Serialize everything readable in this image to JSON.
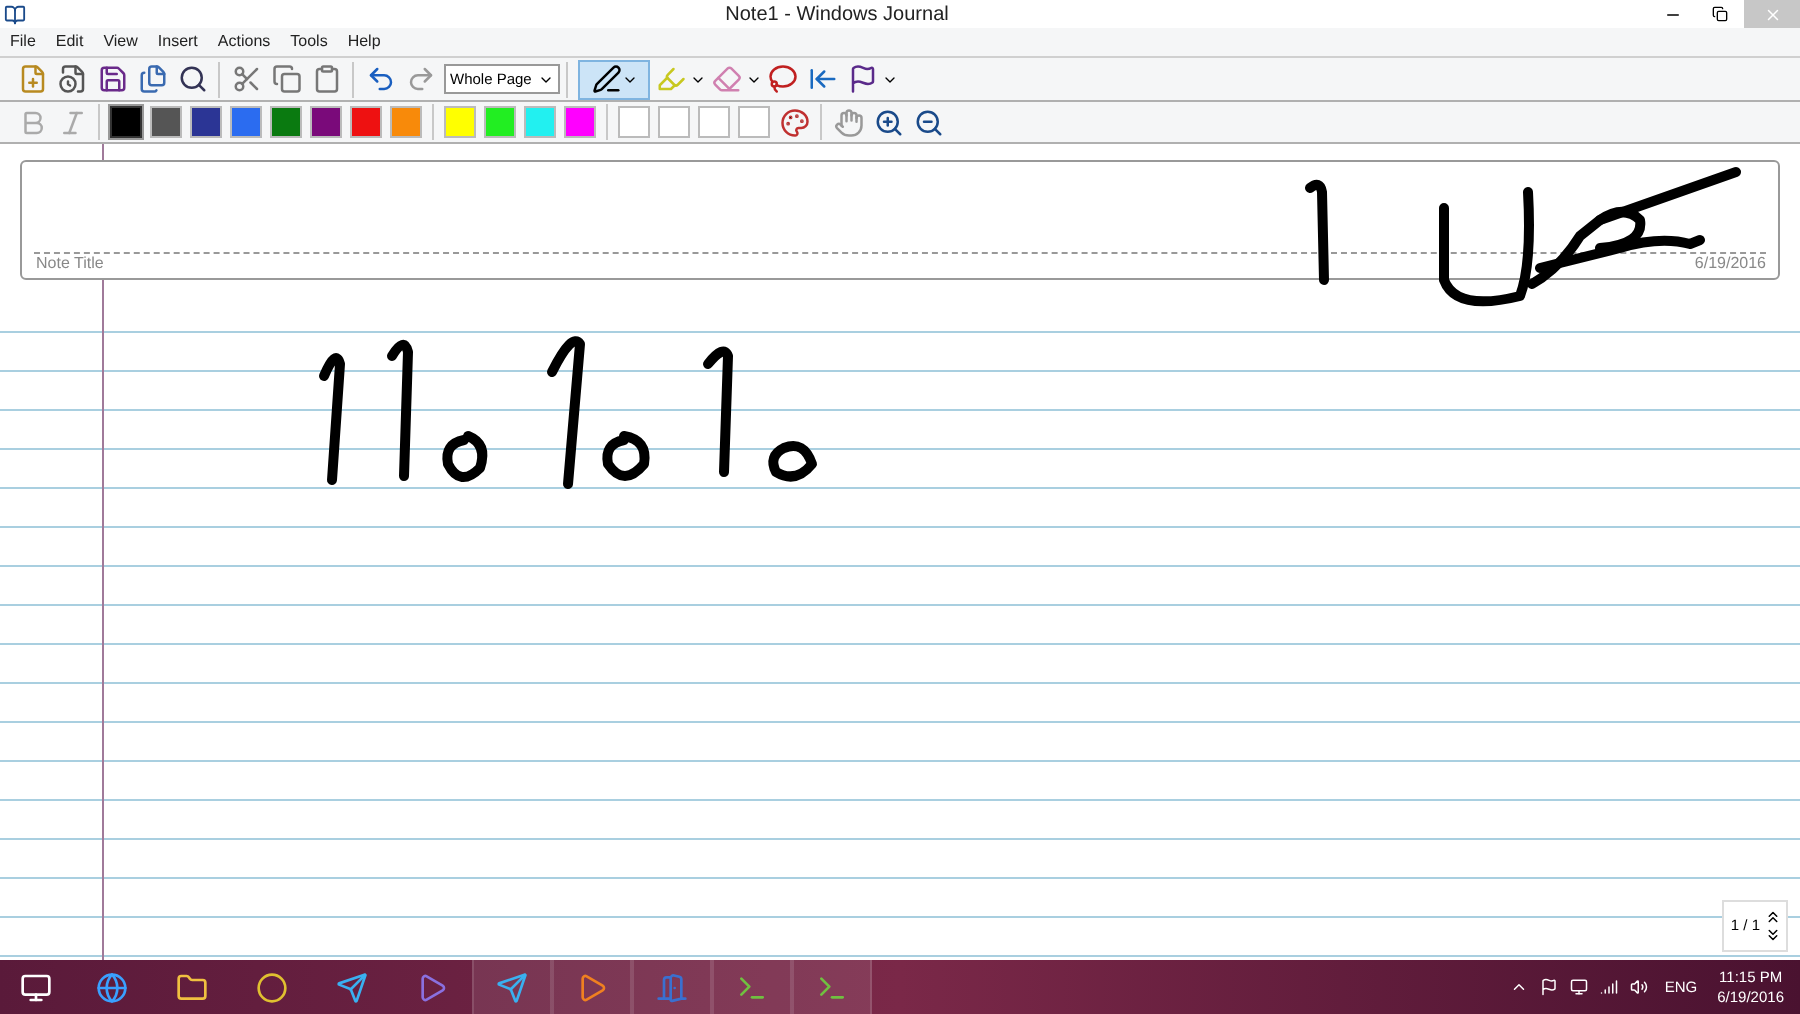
{
  "window": {
    "title": "Note1 - Windows Journal"
  },
  "menu": [
    "File",
    "Edit",
    "View",
    "Insert",
    "Actions",
    "Tools",
    "Help"
  ],
  "toolbar": {
    "zoom_select": {
      "value": "Whole Page"
    },
    "pen_tool": {
      "selected": true
    }
  },
  "pen_colors": [
    {
      "color": "#000000",
      "selected": true
    },
    {
      "color": "#555555",
      "selected": false
    },
    {
      "color": "#2b3595",
      "selected": false
    },
    {
      "color": "#2b6cf0",
      "selected": false
    },
    {
      "color": "#0a7a10",
      "selected": false
    },
    {
      "color": "#7a0a7a",
      "selected": false
    },
    {
      "color": "#ee1111",
      "selected": false
    },
    {
      "color": "#f88a0a",
      "selected": false
    },
    {
      "color": "#ffff00",
      "selected": false
    },
    {
      "color": "#22ee22",
      "selected": false
    },
    {
      "color": "#22f0f0",
      "selected": false
    },
    {
      "color": "#ff00ff",
      "selected": false
    },
    {
      "color": "#ffffff",
      "selected": false
    },
    {
      "color": "#ffffff",
      "selected": false
    },
    {
      "color": "#ffffff",
      "selected": false
    },
    {
      "color": "#ffffff",
      "selected": false
    }
  ],
  "note": {
    "title_placeholder": "Note Title",
    "date": "6/19/2016",
    "page_counter": "1 / 1"
  },
  "taskbar": {
    "language": "ENG",
    "time": "11:15 PM",
    "date": "6/19/2016"
  }
}
